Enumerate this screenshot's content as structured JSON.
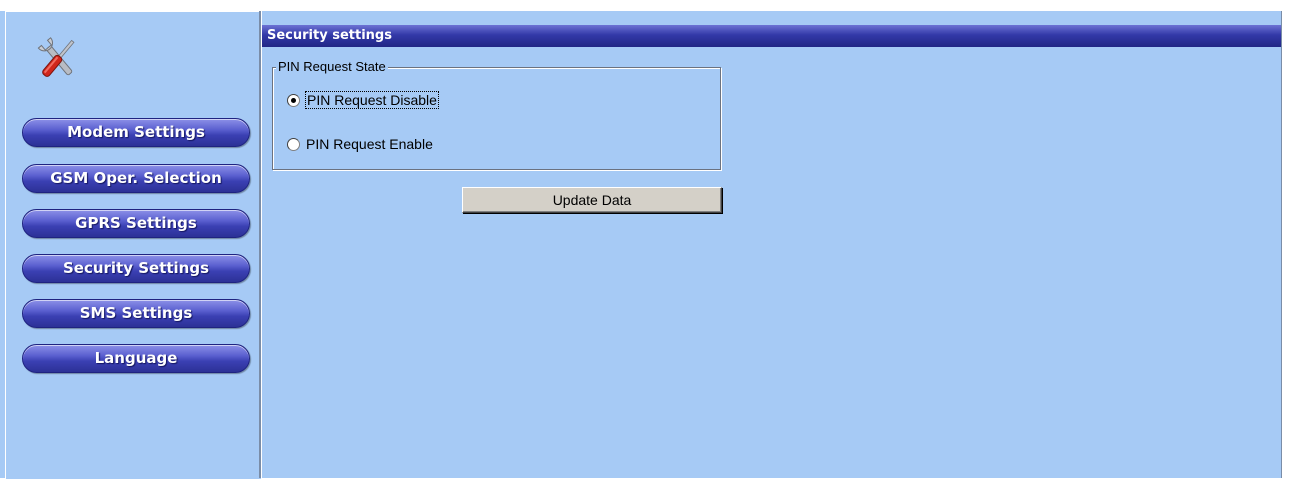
{
  "sidebar": {
    "icon": "tools-icon",
    "buttons": [
      {
        "label": "Modem Settings"
      },
      {
        "label": "GSM Oper. Selection"
      },
      {
        "label": "GPRS Settings"
      },
      {
        "label": "Security Settings"
      },
      {
        "label": "SMS Settings"
      },
      {
        "label": "Language"
      }
    ]
  },
  "main": {
    "title": "Security settings",
    "pin_group": {
      "legend": "PIN Request State",
      "options": [
        {
          "label": "PIN Request Disable",
          "selected": true
        },
        {
          "label": "PIN Request Enable",
          "selected": false
        }
      ]
    },
    "update_button": "Update Data"
  },
  "colors": {
    "background": "#a6caf5",
    "header": "#3339a8",
    "nav_button": "#3b40b3"
  }
}
